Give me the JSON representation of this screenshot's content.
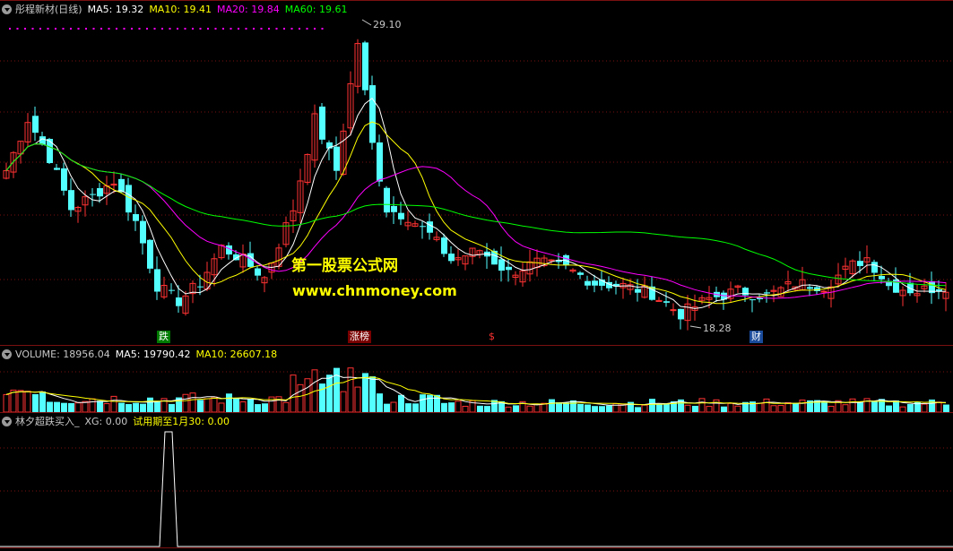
{
  "main": {
    "stock_name": "彤程新材(日线)",
    "ma5": "MA5: 19.32",
    "ma10": "MA10: 19.41",
    "ma20": "MA20: 19.84",
    "ma60": "MA60: 19.61",
    "high_label": "29.10",
    "low_label": "18.28",
    "signal_1": "跌",
    "signal_2": "涨榜",
    "signal_3": "$",
    "signal_4": "财",
    "watermark_cn": "第一股票公式网",
    "watermark_url": "www.chnmoney.com"
  },
  "volume": {
    "title": "VOLUME: 18956.04",
    "ma5": "MA5: 19790.42",
    "ma10": "MA10: 26607.18"
  },
  "indicator": {
    "name": "林夕超跌买入_",
    "xg": "XG: 0.00",
    "trial": "试用期至1月30: 0.00"
  },
  "colors": {
    "up": "#ff3232",
    "down": "#54ffff",
    "ma5": "#ffffff",
    "ma10": "#ffff00",
    "ma20": "#ff00ff",
    "ma60": "#00ff00",
    "border": "#7a1010"
  }
}
